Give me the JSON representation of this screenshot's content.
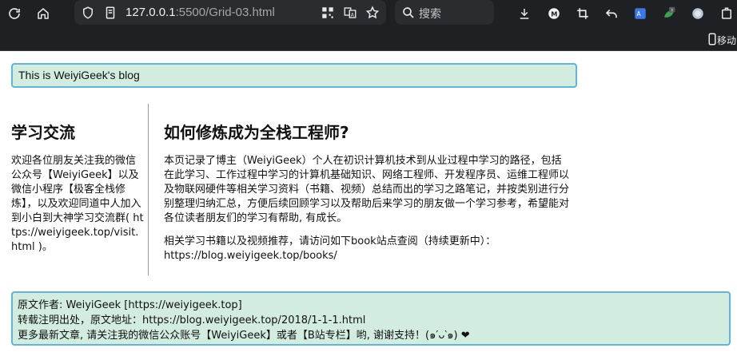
{
  "browser": {
    "address_host": "127.0.0.1",
    "address_rest": ":5500/Grid-03.html",
    "search_placeholder": "搜索",
    "mobile_label": "移动"
  },
  "header": {
    "text": "This is WeiyiGeek's blog"
  },
  "sidebar": {
    "title": "学习交流",
    "text": "欢迎各位朋友关注我的微信公众号【WeiyiGeek】以及微信小程序【极客全栈修炼】，以及欢迎同道中人加入到小白到大神学习交流群( https://weiyigeek.top/visit.html )。"
  },
  "main": {
    "title": "如何修炼成为全栈工程师?",
    "paragraph1": "本页记录了博主（WeiyiGeek）个人在初识计算机技术到从业过程中学习的路径，包括在此学习、工作过程中学习的计算机基础知识、网络工程师、开发程序员、运维工程师以及物联网硬件等相关学习资料（书籍、视频）总结而出的学习之路笔记，并按类别进行分别整理归纳汇总，方便后续回顾学习以及帮助后来学习的朋友做一个学习参考，希望能对各位读者朋友们的学习有帮助, 有成长。",
    "paragraph2": "相关学习书籍以及视频推荐，请访问如下book站点查阅（持续更新中）： https://blog.weiyigeek.top/books/"
  },
  "footer": {
    "line1": "原文作者: WeiyiGeek [https://weiyigeek.top]",
    "line2": "转载注明出处，原文地址：https://blog.weiyigeek.top/2018/1-1-1.html",
    "line3": "更多最新文章, 请关注我的微信公众账号【WeiyiGeek】或者【B站专栏】哟, 谢谢支持！(๑′ᴗ‵๑) ❤"
  }
}
